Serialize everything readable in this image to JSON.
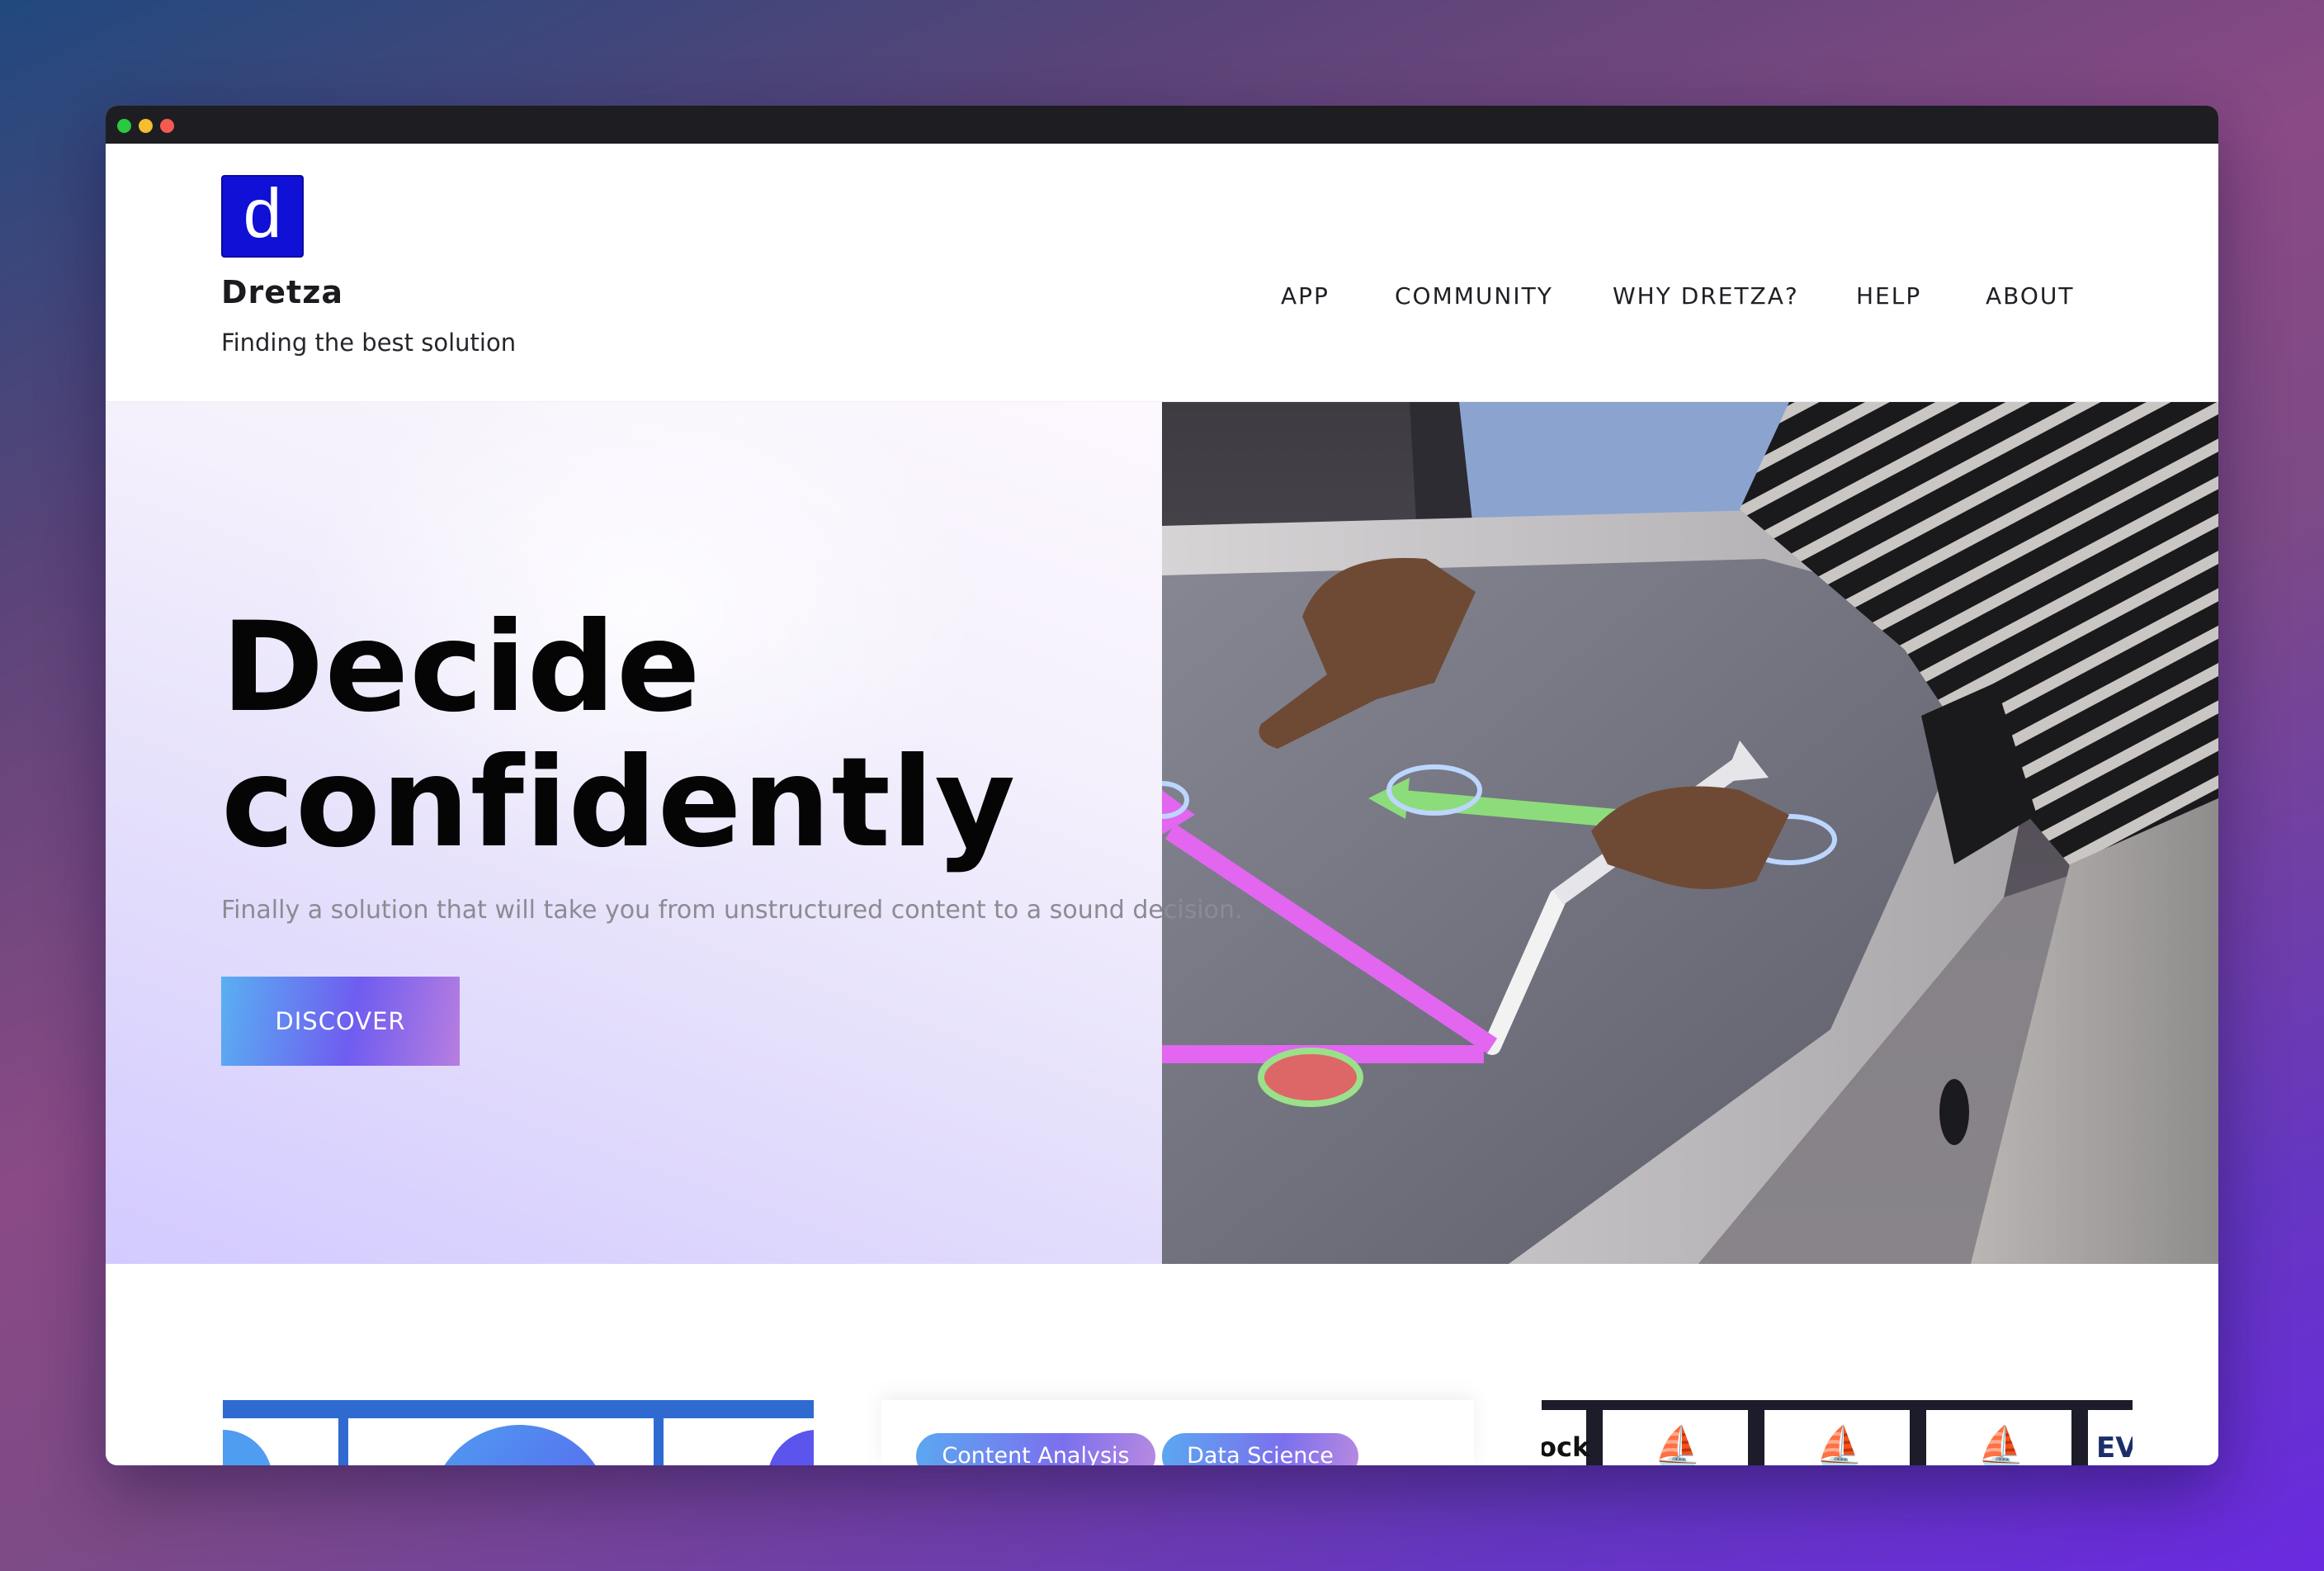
{
  "brand": {
    "logo_letter": "d",
    "name": "Dretza",
    "tagline": "Finding the best solution"
  },
  "nav": {
    "items": [
      {
        "label": "APP"
      },
      {
        "label": "COMMUNITY"
      },
      {
        "label": "WHY DRETZA?"
      },
      {
        "label": "HELP"
      },
      {
        "label": "ABOUT"
      }
    ]
  },
  "hero": {
    "title_line1": "Decide",
    "title_line2": "confidently",
    "subtitle": "Finally a solution that will take you from unstructured content to a sound decision.",
    "cta_label": "DISCOVER"
  },
  "cards": {
    "tags": [
      "Content Analysis",
      "Data Science"
    ],
    "card3_left_text": "ock",
    "card3_right_text": "EV"
  },
  "colors": {
    "logo_bg": "#1010d6",
    "accent_gradient_start": "#59b0f2",
    "accent_gradient_mid": "#6f5cf0",
    "accent_gradient_end": "#b77ee0",
    "titlebar": "#1e1e22"
  }
}
